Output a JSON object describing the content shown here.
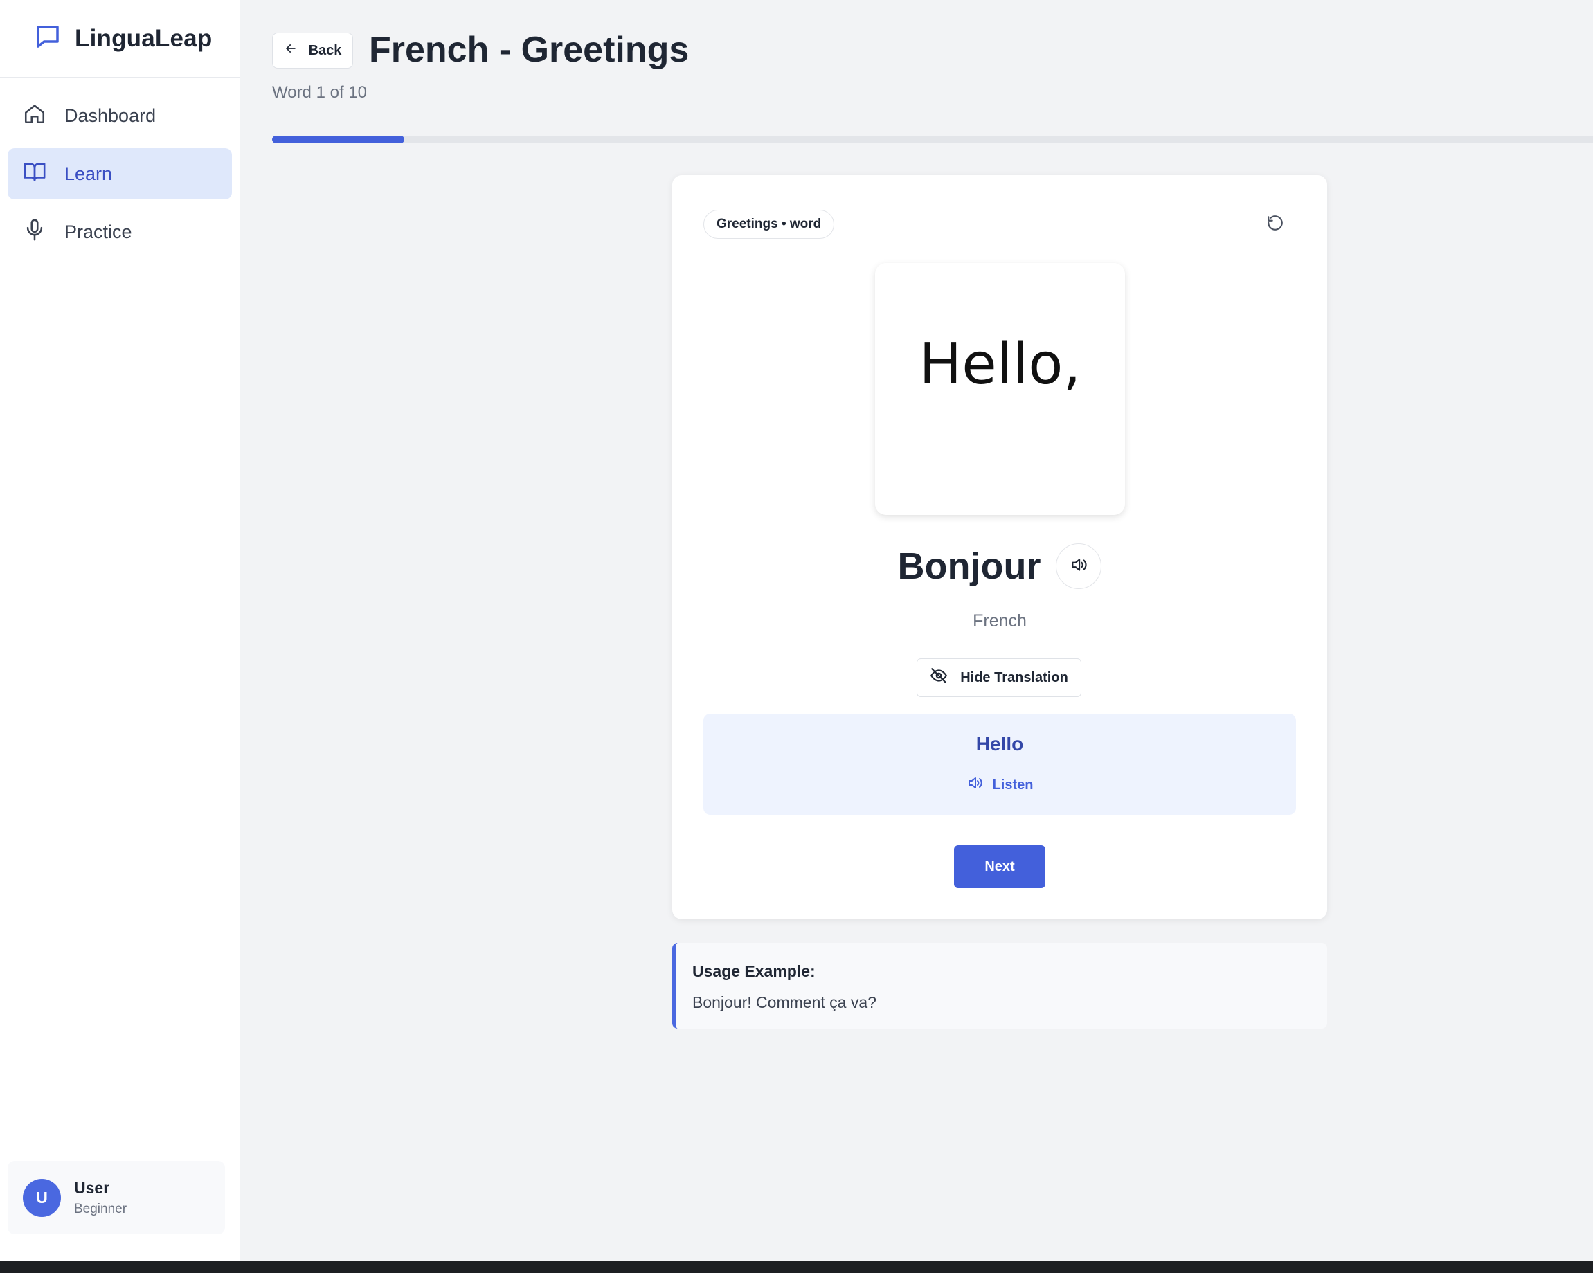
{
  "brand": {
    "name": "LinguaLeap"
  },
  "nav": {
    "items": [
      {
        "label": "Dashboard",
        "icon": "home-icon",
        "active": false
      },
      {
        "label": "Learn",
        "icon": "book-icon",
        "active": true
      },
      {
        "label": "Practice",
        "icon": "microphone-icon",
        "active": false
      }
    ]
  },
  "user": {
    "initial": "U",
    "name": "User",
    "level": "Beginner"
  },
  "header": {
    "back_label": "Back",
    "title": "French - Greetings",
    "subtitle": "Word 1 of 10",
    "progress": 0.1
  },
  "card": {
    "tag": "Greetings • word",
    "image_text": "Hello,",
    "word": "Bonjour",
    "language": "French",
    "toggle_label": "Hide Translation",
    "translation": "Hello",
    "listen_label": "Listen",
    "next_label": "Next"
  },
  "usage": {
    "title": "Usage Example:",
    "text": "Bonjour! Comment ça va?"
  },
  "colors": {
    "accent": "#4360db",
    "active_bg": "#dfe8fb",
    "translation_bg": "#eef3fe"
  }
}
